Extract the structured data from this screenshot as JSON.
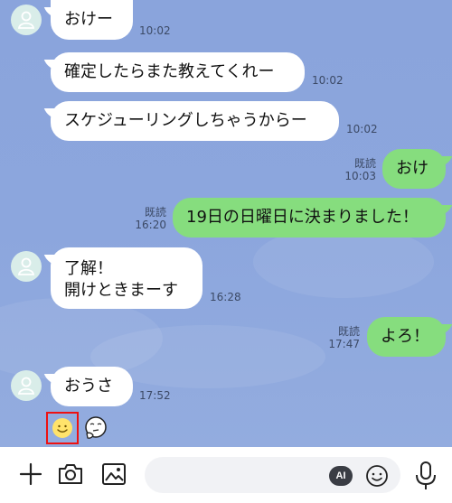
{
  "messages": [
    {
      "id": "m1",
      "text": "おけー",
      "time": "10:02"
    },
    {
      "id": "m2",
      "text": "確定したらまた教えてくれー",
      "time": "10:02"
    },
    {
      "id": "m3",
      "text": "スケジューリングしちゃうからー",
      "time": "10:02"
    },
    {
      "id": "m4",
      "text": "おけ",
      "read": "既読",
      "time": "10:03"
    },
    {
      "id": "m5",
      "text": "19日の日曜日に決まりました！",
      "read": "既読",
      "time": "16:20"
    },
    {
      "id": "m6",
      "text": "了解！\n開けときまーす",
      "time": "16:28"
    },
    {
      "id": "m7",
      "text": "よろ！",
      "read": "既読",
      "time": "17:47"
    },
    {
      "id": "m8",
      "text": "おうさ",
      "time": "17:52"
    }
  ],
  "input_bar": {
    "placeholder": "",
    "ai_label": "AI",
    "icons": [
      "plus-icon",
      "camera-icon",
      "image-icon",
      "emoji-icon",
      "microphone-icon"
    ]
  },
  "reactions": [
    "smile-emoji",
    "thinking-emoji"
  ],
  "colors": {
    "background": "#8aa4dc",
    "incoming_bubble": "#ffffff",
    "outgoing_bubble": "#86dd7e",
    "highlight_border": "#e11111"
  }
}
